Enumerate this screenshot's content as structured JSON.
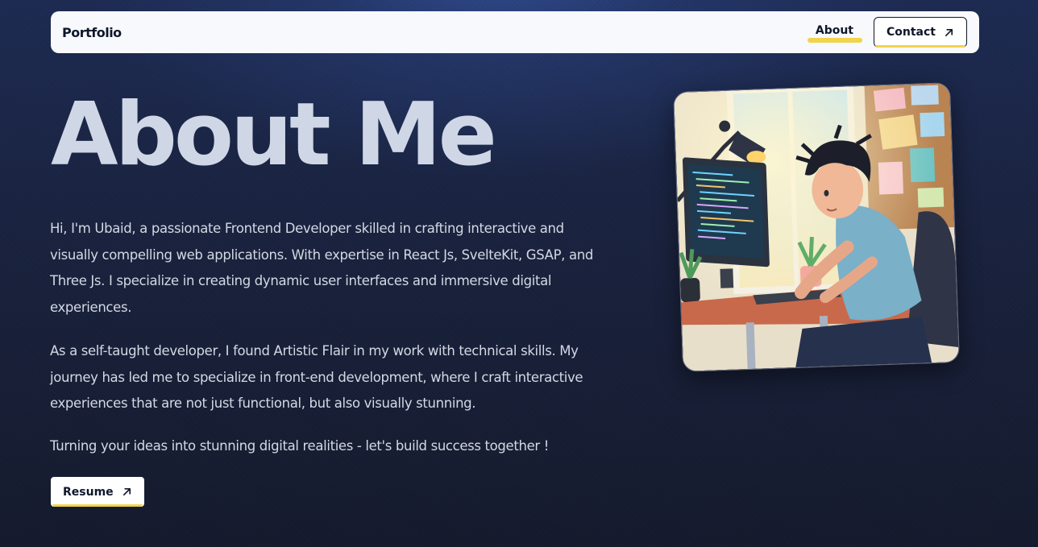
{
  "nav": {
    "brand": "Portfolio",
    "about_label": "About",
    "contact_label": "Contact"
  },
  "hero": {
    "title": "About Me",
    "paragraphs": [
      "Hi, I'm Ubaid, a passionate Frontend Developer skilled in crafting interactive and visually compelling web applications. With expertise in React Js, SvelteKit, GSAP, and Three Js. I specialize in creating dynamic user interfaces and immersive digital experiences.",
      "As a self-taught developer, I found Artistic Flair in my work with technical skills. My journey has led me to specialize in front-end development, where I craft interactive experiences that are not just functional, but also visually stunning.",
      "Turning your ideas into stunning digital realities - let's build success together !"
    ],
    "resume_label": "Resume"
  },
  "icons": {
    "contact": "arrow-up-right-icon",
    "resume": "arrow-up-right-icon"
  },
  "colors": {
    "accent": "#f2d34d",
    "title": "#cfd7e6",
    "text": "#d3d9e4",
    "nav_bg": "#f7f9fc"
  }
}
